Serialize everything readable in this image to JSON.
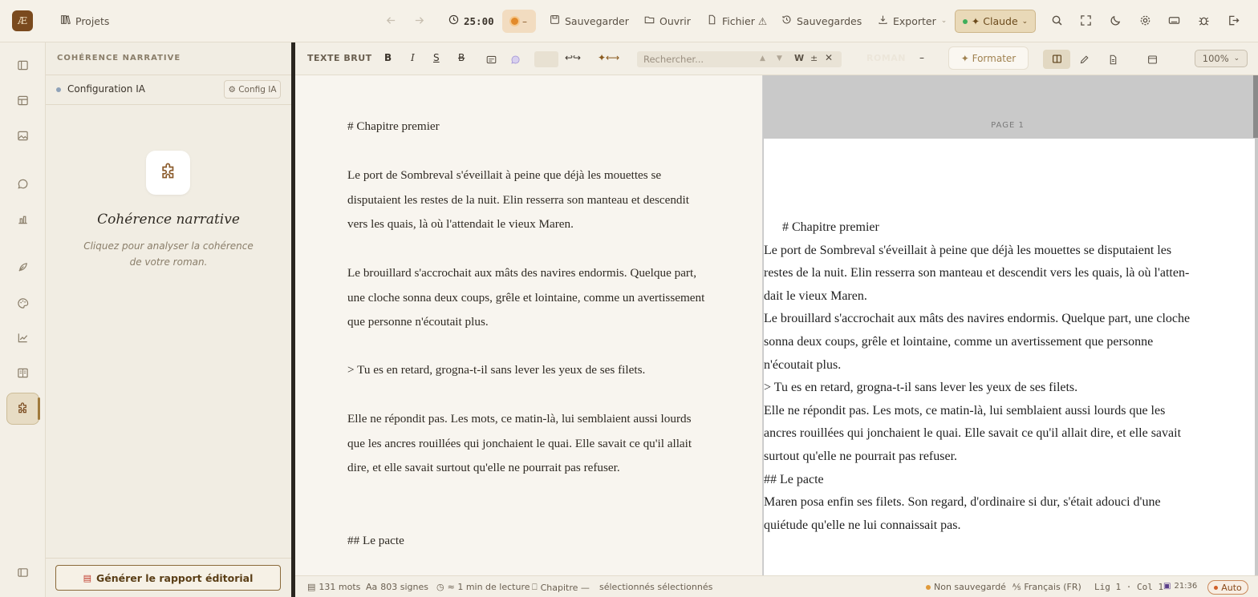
{
  "topbar": {
    "logo": "Æ",
    "projects": "Projets",
    "timer": "25:00",
    "timer_state": "–",
    "save": "Sauvegarder",
    "open": "Ouvrir",
    "file": "Fichier ⚠",
    "backups": "Sauvegardes",
    "export": "Exporter",
    "ai_model": "✦ Claude"
  },
  "panel": {
    "title": "COHÉRENCE NARRATIVE",
    "config_label": "Configuration IA",
    "config_button": "⚙ Config IA",
    "empty_title": "Cohérence narrative",
    "empty_subtitle": "Cliquez pour analyser la cohérence de votre roman.",
    "generate_button": "Générer le rapport éditorial"
  },
  "editor_toolbar": {
    "mode": "TEXTE BRUT",
    "bold": "B",
    "italic": "I",
    "underline": "S",
    "strike": "B",
    "search_placeholder": "Rechercher...",
    "whole_word": "W",
    "plus_minus": "±",
    "genre": "ROMAN",
    "genre_dash": "–",
    "format": "✦ Formater",
    "zoom": "100%"
  },
  "editor": {
    "paragraphs": [
      "# Chapitre premier",
      "Le port de Sombreval s'éveillait à peine que déjà les mouettes se disputaient les restes de la nuit. Elin resserra son manteau et descendit vers les quais, là où l'attendait le vieux Maren.",
      "Le brouillard s'accrochait aux mâts des navires endormis. Quelque part, une cloche sonna deux coups, grêle et lointaine, comme un avertissement que personne n'écoutait plus.",
      "> Tu es en retard, grogna-t-il sans lever les yeux de ses filets.",
      "Elle ne répondit pas. Les mots, ce matin-là, lui semblaient aussi lourds que les ancres rouillées qui jonchaient le quai. Elle savait ce qu'il allait dire, et elle savait surtout qu'elle ne pourrait pas refuser.",
      "## Le pacte"
    ]
  },
  "preview": {
    "page_label": "PAGE 1",
    "lines": [
      "# Chapitre premier",
      "Le port de Sombreval s'éveillait à peine que déjà les mouettes se disputaient les",
      "restes de la nuit. Elin resserra son manteau et descendit vers les quais, là où l'atten-",
      "dait le vieux Maren.",
      "Le brouillard s'accrochait aux mâts des navires endormis. Quelque part, une cloche",
      "sonna deux coups, grêle et lointaine, comme un avertissement que personne",
      "n'écoutait plus.",
      "> Tu es en retard, grogna-t-il sans lever les yeux de ses filets.",
      "Elle ne répondit pas. Les mots, ce matin-là, lui semblaient aussi lourds que les",
      "ancres rouillées qui jonchaient le quai. Elle savait ce qu'il allait dire, et elle savait",
      "surtout qu'elle ne pourrait pas refuser.",
      "## Le pacte",
      "Maren posa enfin ses filets. Son regard, d'ordinaire si dur, s'était adouci d'une",
      "quiétude qu'elle ne lui connaissait pas."
    ]
  },
  "status": {
    "words": "131 mots",
    "signs": "803 signes",
    "reading": "≈ 1 min de lecture",
    "chapter": "Chapitre —",
    "selected": "sélectionnés  sélectionnés",
    "unsaved": "Non sauvegardé",
    "language": "Français (FR)",
    "position": "Lig 1 · Col 1",
    "time": "21:36",
    "auto": "Auto"
  }
}
